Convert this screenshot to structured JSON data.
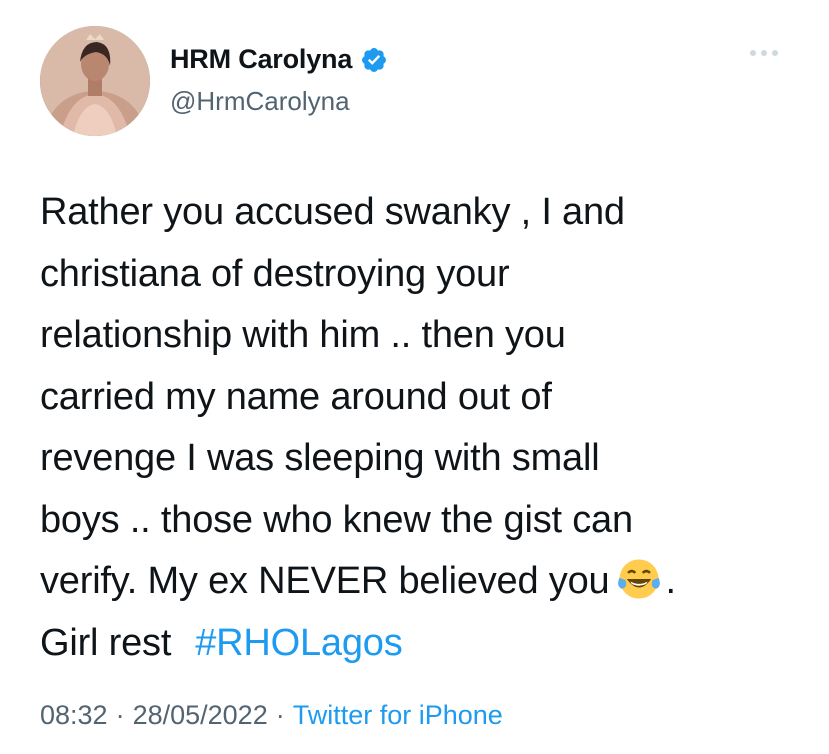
{
  "user": {
    "display_name": "HRM Carolyna",
    "handle": "@HrmCarolyna",
    "verified": true
  },
  "tweet": {
    "lines": [
      "Rather you accused swanky , I and",
      "christiana of destroying your",
      "relationship with him .. then you",
      "carried my name around out of",
      "revenge I was sleeping with small",
      "boys .. those who knew the gist can"
    ],
    "line7_before_emoji": "verify. My ex NEVER believed you",
    "line7_after_emoji": ".",
    "emoji": "face-with-tears-of-joy",
    "line8_text": "Girl rest",
    "hashtag": "#RHOLagos"
  },
  "meta": {
    "time": "08:32",
    "separator": "·",
    "date": "28/05/2022",
    "source": "Twitter for iPhone"
  },
  "colors": {
    "link": "#1d9bf0",
    "secondary_text": "#536471",
    "primary_text": "#0f1419"
  },
  "icons": [
    "avatar-image",
    "verified-badge-icon",
    "more-options-icon",
    "tears-of-joy-emoji-icon"
  ]
}
